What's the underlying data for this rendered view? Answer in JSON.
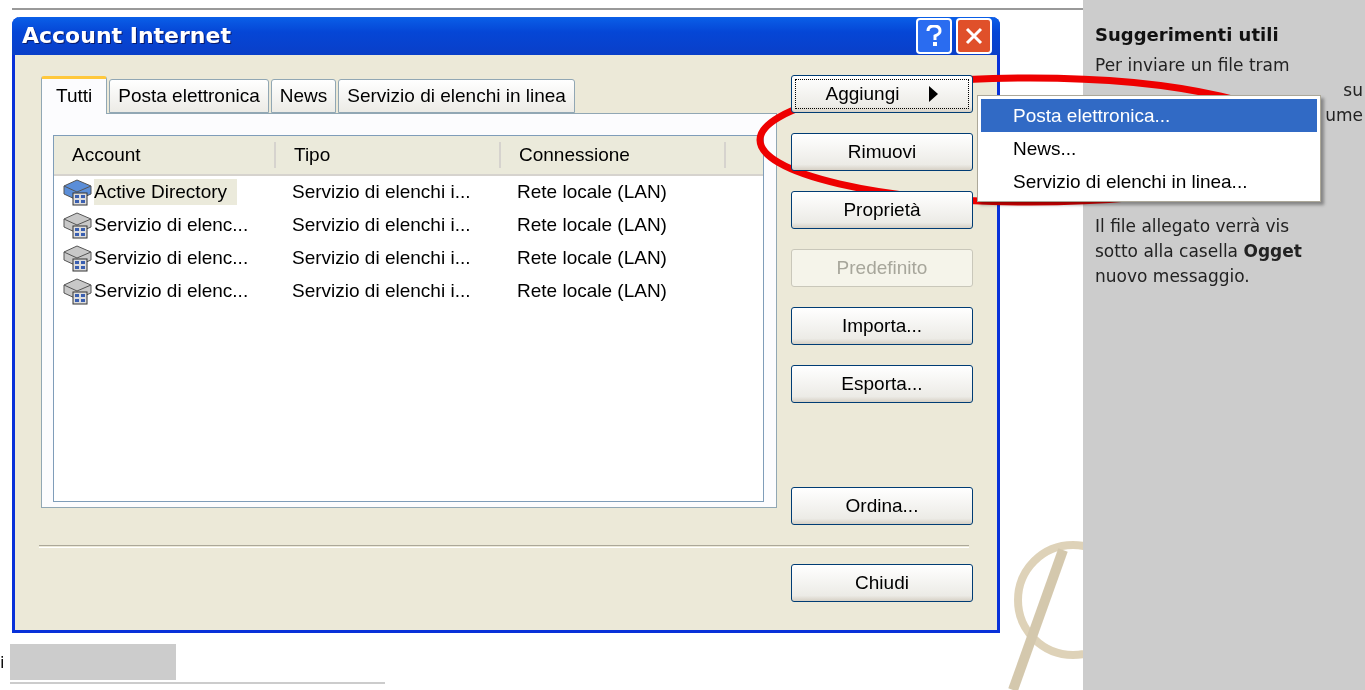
{
  "background_page": {
    "panel_title": "Suggerimenti utili",
    "panel_lines": [
      {
        "text": "Per inviare un file tram",
        "kind": "line"
      },
      {
        "text": "su",
        "kind": "fragment"
      },
      {
        "text": "ume",
        "kind": "fragment"
      },
      {
        "text": "Il file allegato verrà vis",
        "kind": "line"
      },
      {
        "text": "sotto alla casella **Ogget**",
        "kind": "line"
      },
      {
        "text": "nuovo messaggio.",
        "kind": "line"
      }
    ],
    "left_fragment": "i"
  },
  "dialog": {
    "title": "Account Internet",
    "tabs": [
      {
        "label": "Tutti",
        "selected": true
      },
      {
        "label": "Posta elettronica",
        "selected": false
      },
      {
        "label": "News",
        "selected": false
      },
      {
        "label": "Servizio di elenchi in linea",
        "selected": false
      }
    ],
    "columns": [
      "Account",
      "Tipo",
      "Connessione"
    ],
    "rows": [
      {
        "account": "Active Directory",
        "type": "Servizio di elenchi i...",
        "connection": "Rete locale (LAN)",
        "selected": true
      },
      {
        "account": "Servizio di elenc...",
        "type": "Servizio di elenchi i...",
        "connection": "Rete locale (LAN)",
        "selected": false
      },
      {
        "account": "Servizio di elenc...",
        "type": "Servizio di elenchi i...",
        "connection": "Rete locale (LAN)",
        "selected": false
      },
      {
        "account": "Servizio di elenc...",
        "type": "Servizio di elenchi i...",
        "connection": "Rete locale (LAN)",
        "selected": false
      }
    ],
    "buttons": [
      {
        "label": "Aggiungi",
        "disabled": false,
        "focused": true,
        "submenu": true,
        "gap": false
      },
      {
        "label": "Rimuovi",
        "disabled": false,
        "focused": false,
        "submenu": false,
        "gap": false
      },
      {
        "label": "Proprietà",
        "disabled": false,
        "focused": false,
        "submenu": false,
        "gap": false
      },
      {
        "label": "Predefinito",
        "disabled": true,
        "focused": false,
        "submenu": false,
        "gap": false
      },
      {
        "label": "Importa...",
        "disabled": false,
        "focused": false,
        "submenu": false,
        "gap": false
      },
      {
        "label": "Esporta...",
        "disabled": false,
        "focused": false,
        "submenu": false,
        "gap": false
      },
      {
        "label": "Ordina...",
        "disabled": false,
        "focused": false,
        "submenu": false,
        "gap": true
      }
    ],
    "close_button": "Chiudi"
  },
  "submenu": {
    "items": [
      {
        "label": "Posta elettronica...",
        "selected": true
      },
      {
        "label": "News...",
        "selected": false
      },
      {
        "label": "Servizio di elenchi in linea...",
        "selected": false
      }
    ]
  }
}
